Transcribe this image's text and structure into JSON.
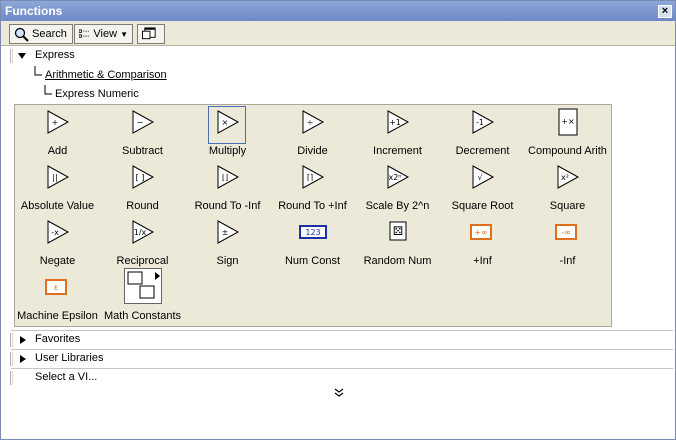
{
  "window": {
    "title": "Functions"
  },
  "toolbar": {
    "search_label": "Search",
    "view_label": "View"
  },
  "tree": {
    "express_label": "Express",
    "arith_label": "Arithmetic & Comparison",
    "numeric_label": "Express Numeric",
    "favorites_label": "Favorites",
    "user_libraries_label": "User Libraries",
    "select_vi_label": "Select a VI..."
  },
  "palette": {
    "items": [
      {
        "label": "Add",
        "glyph": "+"
      },
      {
        "label": "Subtract",
        "glyph": "−"
      },
      {
        "label": "Multiply",
        "glyph": "×"
      },
      {
        "label": "Divide",
        "glyph": "÷"
      },
      {
        "label": "Increment",
        "glyph": "+1"
      },
      {
        "label": "Decrement",
        "glyph": "-1"
      },
      {
        "label": "Compound Arith",
        "glyph": "+×"
      },
      {
        "label": "Absolute Value",
        "glyph": "||"
      },
      {
        "label": "Round",
        "glyph": "[ ]"
      },
      {
        "label": "Round To -Inf",
        "glyph": "⌊⌋"
      },
      {
        "label": "Round To +Inf",
        "glyph": "⌈⌉"
      },
      {
        "label": "Scale By 2^n",
        "glyph": "x2ⁿ"
      },
      {
        "label": "Square Root",
        "glyph": "√"
      },
      {
        "label": "Square",
        "glyph": "x²"
      },
      {
        "label": "Negate",
        "glyph": "-x"
      },
      {
        "label": "Reciprocal",
        "glyph": "1/x"
      },
      {
        "label": "Sign",
        "glyph": "±"
      },
      {
        "label": "Num Const",
        "glyph": "123"
      },
      {
        "label": "Random Num",
        "glyph": "⚄"
      },
      {
        "label": "+Inf",
        "glyph": "+∞"
      },
      {
        "label": "-Inf",
        "glyph": "-∞"
      },
      {
        "label": "Machine Epsilon",
        "glyph": "ε"
      },
      {
        "label": "Math Constants",
        "glyph": "π e"
      }
    ]
  },
  "colors": {
    "title_bar": "#6d89c6",
    "selection": "#4a6fb5",
    "const_blue": "#1c2fa8",
    "inf_orange": "#e07020"
  }
}
